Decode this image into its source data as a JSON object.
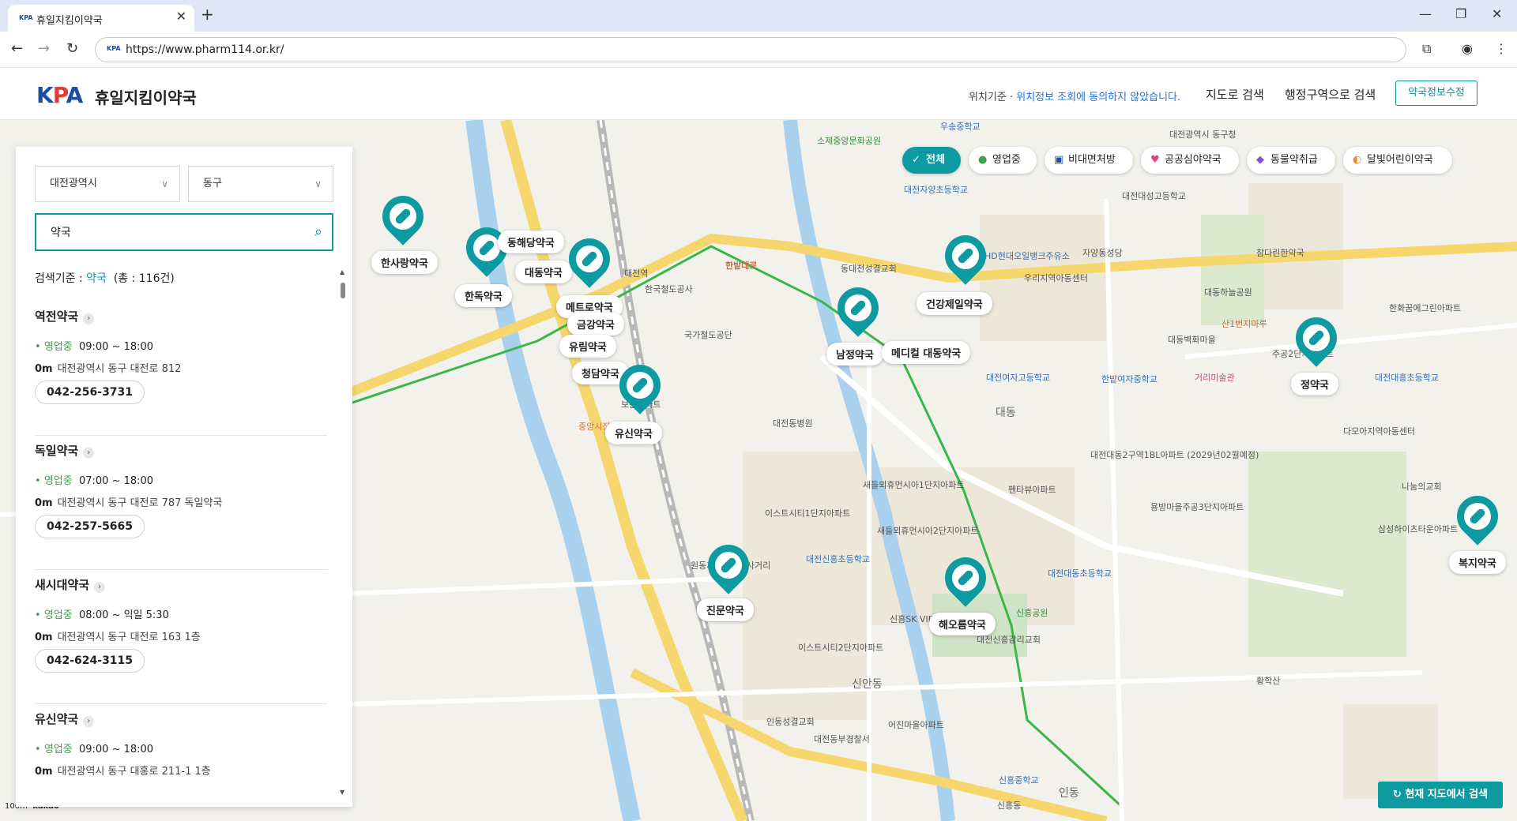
{
  "browser": {
    "tab_title": "휴일지킴이약국",
    "url": "https://www.pharm114.or.kr/",
    "favicon": "KPA"
  },
  "header": {
    "logo_k": "K",
    "logo_p": "P",
    "logo_a": "A",
    "site_name": "휴일지킴이약국",
    "loc_prefix": "위치기준 · ",
    "loc_status": "위치정보 조회에 동의하지 않았습니다.",
    "nav_map": "지도로 검색",
    "nav_region": "행정구역으로 검색",
    "correction_button": "약국정보수정"
  },
  "panel": {
    "city": "대전광역시",
    "district": "동구",
    "search_value": "약국",
    "criteria_prefix": "검색기준 : ",
    "criteria_keyword": "약국",
    "criteria_count": "(총 : 116건)",
    "pharmacies": [
      {
        "name": "역전약국",
        "status": "영업중",
        "hours": "09:00 ~ 18:00",
        "distance": "0m",
        "address": "대전광역시 동구 대전로 812",
        "phone": "042-256-3731"
      },
      {
        "name": "독일약국",
        "status": "영업중",
        "hours": "07:00 ~ 18:00",
        "distance": "0m",
        "address": "대전광역시 동구 대전로 787 독일약국",
        "phone": "042-257-5665"
      },
      {
        "name": "새시대약국",
        "status": "영업중",
        "hours": "08:00 ~ 익일 5:30",
        "distance": "0m",
        "address": "대전광역시 동구 대전로 163 1층",
        "phone": "042-624-3115"
      },
      {
        "name": "유신약국",
        "status": "영업중",
        "hours": "09:00 ~ 18:00",
        "distance": "0m",
        "address": "대전광역시 동구 대홍로 211-1 1층",
        "phone": ""
      }
    ]
  },
  "filters": [
    {
      "label": "전체",
      "icon": "✓",
      "active": true
    },
    {
      "label": "영업중",
      "icon": "●"
    },
    {
      "label": "비대면처방",
      "icon": "▣"
    },
    {
      "label": "공공심야약국",
      "icon": "♥"
    },
    {
      "label": "동물약취급",
      "icon": "◆"
    },
    {
      "label": "달빛어린이약국",
      "icon": "◐"
    }
  ],
  "map": {
    "search_here": "현재 지도에서 검색",
    "scale": "100m",
    "provider": "kakao",
    "pharmacy_labels": [
      "한사랑약국",
      "동해당약국",
      "대동약국",
      "한독약국",
      "메트로약국",
      "금강약국",
      "유림약국",
      "청담약국",
      "유신약국",
      "남정약국",
      "메디컬 대동약국",
      "건강제일약국",
      "정약국",
      "복지약국",
      "진문약국",
      "해오름약국"
    ],
    "place_labels": [
      "한밭대로",
      "대동",
      "신안동",
      "대동하늘공원",
      "대전광역시 동구청",
      "인동",
      "신흥동",
      "대전역",
      "중앙시장",
      "소제중앙문화공원",
      "우송중학교",
      "자양동성당",
      "대전대성고등학교",
      "대동벽화마을",
      "삼성하이츠타운아파트",
      "나눔의교회",
      "황학산",
      "대전대흥초등학교",
      "HD현대오일뱅크주유소",
      "보문아파트",
      "원동자동차공업사거리",
      "대전신흥초등학교",
      "이스트시티1단지아파트",
      "이스트시티2단지아파트",
      "대전대동초등학교",
      "신흥SK VIEW아파트",
      "대전신흥감리교회",
      "신흥공원",
      "신흥중학교",
      "어진마을아파트",
      "대전동부경찰서",
      "인동성결교회",
      "대전동병원",
      "새들뫼휴먼시아1단지아파트",
      "새들뫼휴먼시아2단지아파트",
      "펜타뷰아파트",
      "대전대동2구역1BL아파트 (2029년02월예정)",
      "용방마을주공3단지아파트",
      "다모아지역아동센터",
      "주공2단지아파트",
      "한화꿈에그린아파트",
      "참다린한약국",
      "대전자양초등학교",
      "우리지역아동센터",
      "대전여자고등학교",
      "한밭여자중학교",
      "거리미술관",
      "산1번지마루",
      "동대전성결교회",
      "한국철도공사",
      "국가철도공단"
    ]
  }
}
